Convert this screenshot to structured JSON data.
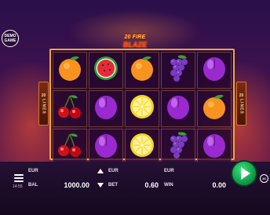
{
  "logo": {
    "top": "20 FIRE",
    "bottom": "BLAZE"
  },
  "demo_badge": {
    "line1": "DEMO",
    "line2": "GAME"
  },
  "lines_indicator": {
    "number": "20",
    "word": "LINES"
  },
  "reels": {
    "columns": [
      [
        "orange",
        "cherry",
        "cherry"
      ],
      [
        "watermelon",
        "plum",
        "plum"
      ],
      [
        "orange",
        "lemon",
        "lemon"
      ],
      [
        "grape",
        "plum",
        "grape"
      ],
      [
        "plum",
        "orange",
        "plum"
      ]
    ]
  },
  "bottom_bar": {
    "balance_currency": "EUR",
    "balance_label": "BAL",
    "balance_value": "1000.00",
    "bet_currency": "EUR",
    "bet_label": "BET",
    "bet_value": "0.60",
    "win_currency": "EUR",
    "win_label": "WIN",
    "win_value": "0.00",
    "clock": "14:55",
    "autoplay_label": "40"
  },
  "colors": {
    "frame": "#f0a640",
    "spin": "#14b556",
    "background": "#4a1450"
  }
}
